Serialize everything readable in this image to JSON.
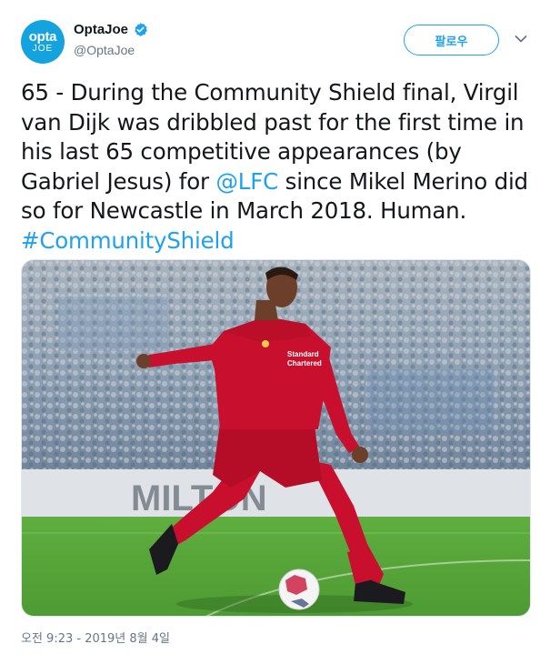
{
  "account": {
    "avatar_text_top": "opta",
    "avatar_text_bottom": "JOE",
    "display_name": "OptaJoe",
    "handle": "@OptaJoe",
    "verified": true
  },
  "actions": {
    "follow_label": "팔로우"
  },
  "tweet": {
    "text_before_mention": "65 - During the Community Shield final, Virgil van Dijk was dribbled past for the first time in his last 65 competitive appearances (by Gabriel Jesus) for ",
    "mention": "@LFC",
    "text_after_mention": " since Mikel Merino did so for Newcastle in March 2018. Human.",
    "hashtag": "#CommunityShield"
  },
  "media": {
    "shirt_sponsor_line1": "Standard",
    "shirt_sponsor_line2": "Chartered",
    "banner_text": "MILTON"
  },
  "timestamp": "오전 9:23 - 2019년 8월 4일",
  "colors": {
    "link": "#1da1f2",
    "avatar_bg": "#15a3e0",
    "kit_red": "#c8102e",
    "pitch_green": "#58a83a"
  }
}
